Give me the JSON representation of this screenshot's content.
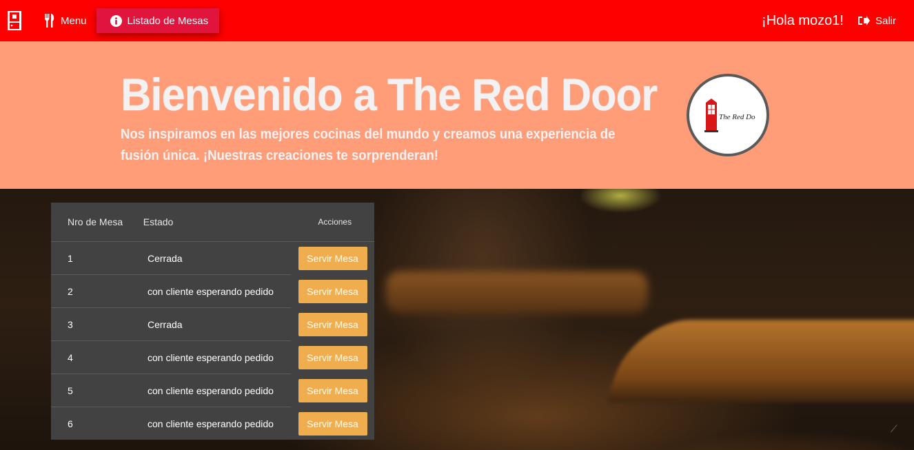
{
  "navbar": {
    "brand_icon": "door-icon",
    "menu_label": "Menu",
    "mesas_label": "Listado de Mesas",
    "greeting": "¡Hola mozo1!",
    "logout_label": "Salir",
    "colors": {
      "background": "#ff0000",
      "active": "#e0143c"
    }
  },
  "hero": {
    "title": "Bienvenido a The Red Door",
    "subtitle": "Nos inspiramos en las mejores cocinas del mundo y creamos una experiencia de fusión única. ¡Nuestras creaciones te sorprenderan!",
    "logo_text": "The Red Door",
    "background": "#ff9d79"
  },
  "mesas": {
    "headers": {
      "numero": "Nro de Mesa",
      "estado": "Estado",
      "acciones": "Acciones"
    },
    "rows": [
      {
        "numero": "1",
        "estado": "Cerrada",
        "accion": "Servir Mesa"
      },
      {
        "numero": "2",
        "estado": "con cliente esperando pedido",
        "accion": "Servir Mesa"
      },
      {
        "numero": "3",
        "estado": "Cerrada",
        "accion": "Servir Mesa"
      },
      {
        "numero": "4",
        "estado": "con cliente esperando pedido",
        "accion": "Servir Mesa"
      },
      {
        "numero": "5",
        "estado": "con cliente esperando pedido",
        "accion": "Servir Mesa"
      },
      {
        "numero": "6",
        "estado": "con cliente esperando pedido",
        "accion": "Servir Mesa"
      }
    ],
    "button_color": "#f0ad4e"
  }
}
